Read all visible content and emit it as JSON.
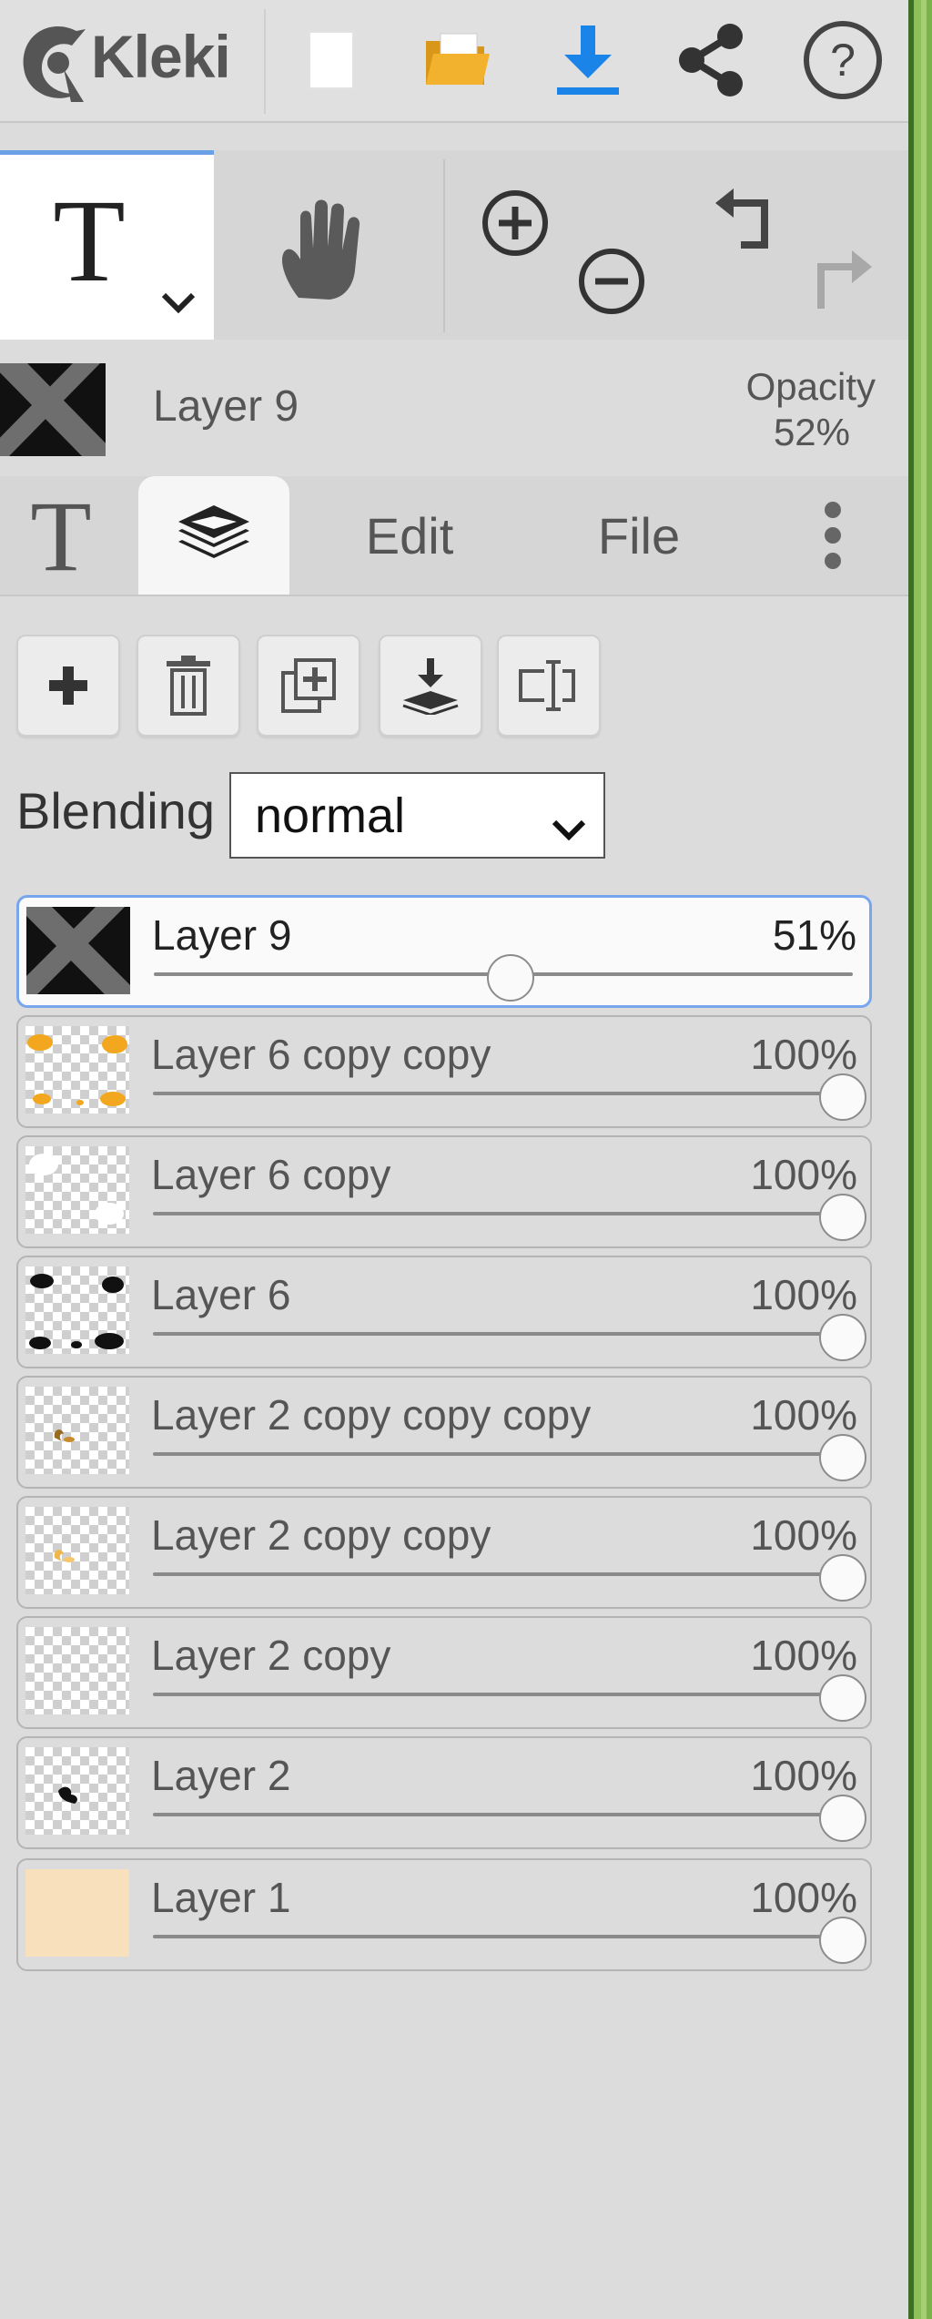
{
  "app": {
    "name": "Kleki"
  },
  "layer_header": {
    "name": "Layer 9",
    "opacity_label": "Opacity",
    "opacity_value": "52%"
  },
  "tabs": [
    {
      "label": ""
    },
    {
      "label": ""
    },
    {
      "label": "Edit"
    },
    {
      "label": "File"
    }
  ],
  "blending": {
    "label": "Blending",
    "value": "normal"
  },
  "layers": [
    {
      "name": "Layer 9",
      "opacity": "51%",
      "level": 0.51,
      "selected": true
    },
    {
      "name": "Layer 6 copy copy",
      "opacity": "100%",
      "level": 1.0
    },
    {
      "name": "Layer 6 copy",
      "opacity": "100%",
      "level": 1.0
    },
    {
      "name": "Layer 6",
      "opacity": "100%",
      "level": 1.0
    },
    {
      "name": "Layer 2 copy copy copy",
      "opacity": "100%",
      "level": 1.0
    },
    {
      "name": "Layer 2 copy copy",
      "opacity": "100%",
      "level": 1.0
    },
    {
      "name": "Layer 2 copy",
      "opacity": "100%",
      "level": 1.0
    },
    {
      "name": "Layer 2",
      "opacity": "100%",
      "level": 1.0
    },
    {
      "name": "Layer 1",
      "opacity": "100%",
      "level": 1.0
    }
  ],
  "icons": {
    "top": [
      "kleki-logo-icon",
      "new-file-icon",
      "open-folder-icon",
      "download-icon",
      "share-icon",
      "help-icon"
    ],
    "tools": [
      "text-tool-icon",
      "hand-tool-icon",
      "zoom-in-icon",
      "zoom-out-icon",
      "undo-icon",
      "redo-icon"
    ],
    "layer_actions": [
      "add-layer-icon",
      "delete-layer-icon",
      "duplicate-layer-icon",
      "merge-down-icon",
      "rename-layer-icon"
    ]
  },
  "colors": {
    "accent": "#1a84e8",
    "selection_border": "#78a6ec",
    "folder": "#f2b22e",
    "layer1_fill": "#f9e0bd"
  }
}
